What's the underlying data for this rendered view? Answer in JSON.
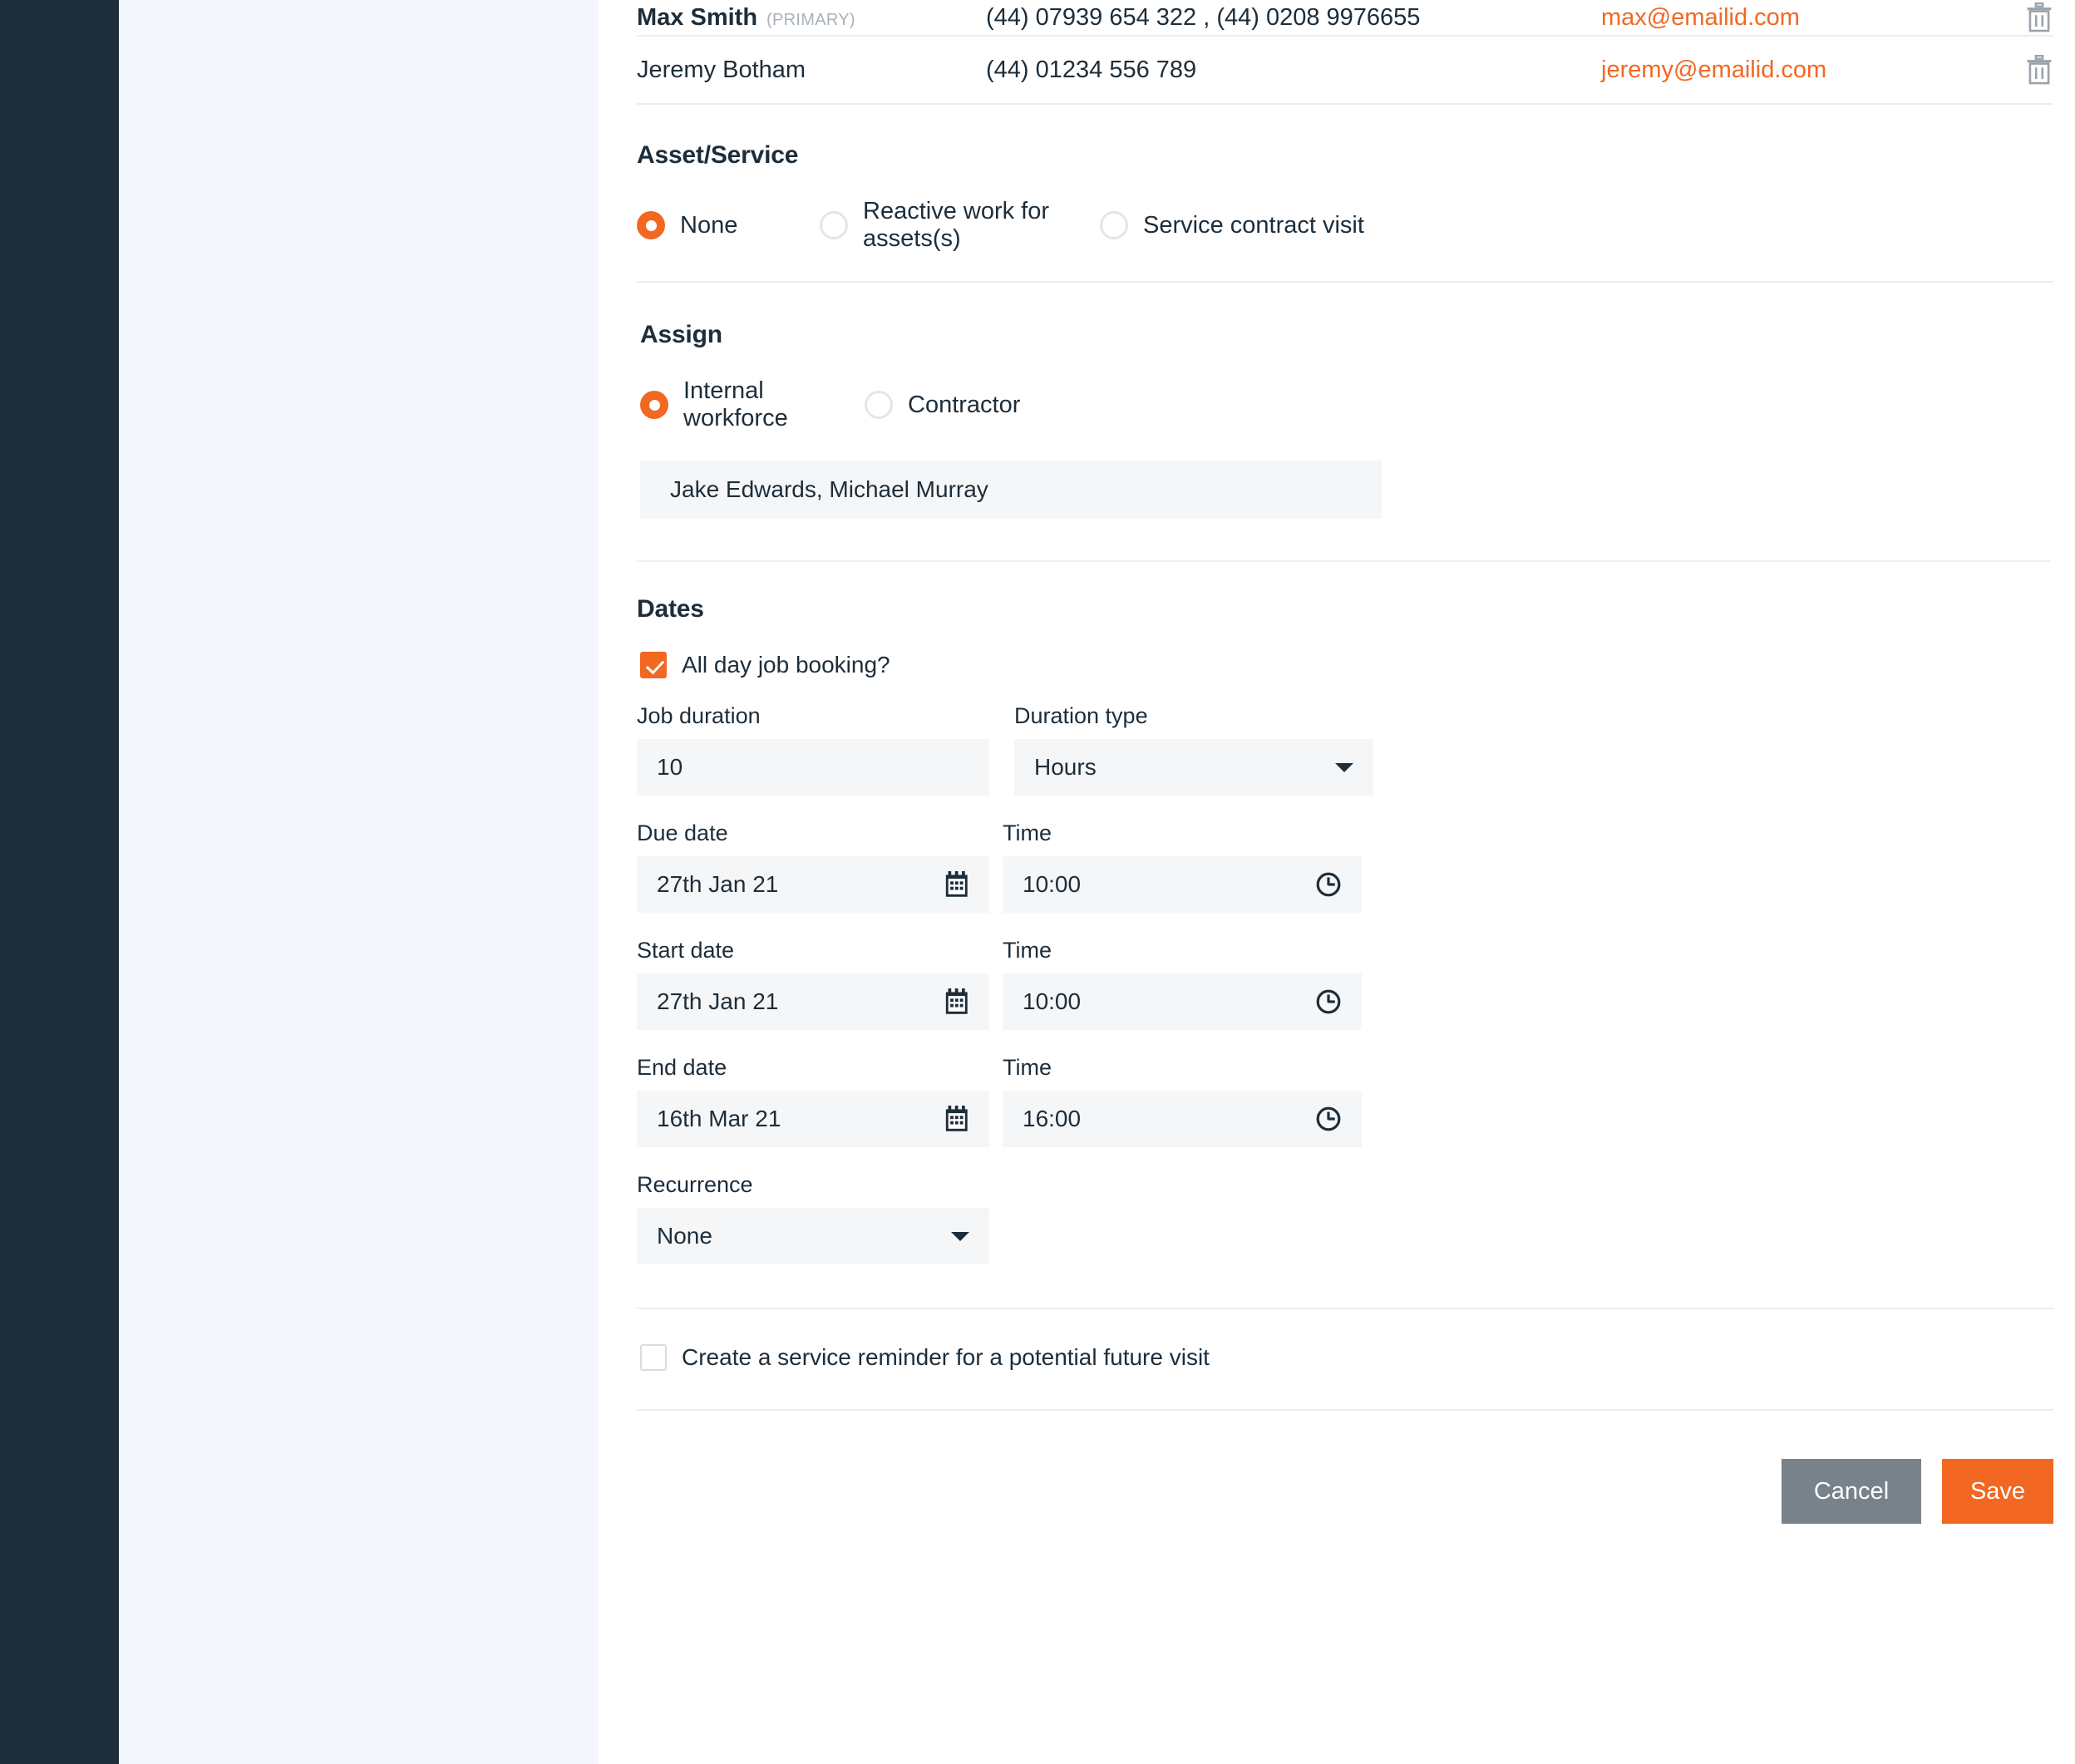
{
  "contacts": {
    "rows": [
      {
        "name": "Max Smith",
        "primary_tag": "(PRIMARY)",
        "phone": "(44) 07939 654 322 , (44) 0208 9976655",
        "email": "max@emailid.com",
        "delete_icon": "trash-icon"
      },
      {
        "name": "Jeremy Botham",
        "primary_tag": "",
        "phone": "(44) 01234 556 789",
        "email": "jeremy@emailid.com",
        "delete_icon": "trash-icon"
      }
    ]
  },
  "asset_service": {
    "title": "Asset/Service",
    "options": [
      {
        "label": "None",
        "selected": true
      },
      {
        "label": "Reactive work for assets(s)",
        "selected": false
      },
      {
        "label": "Service contract visit",
        "selected": false
      }
    ]
  },
  "assign": {
    "title": "Assign",
    "options": [
      {
        "label": "Internal workforce",
        "selected": true
      },
      {
        "label": "Contractor",
        "selected": false
      }
    ],
    "assignees": "Jake Edwards, Michael Murray"
  },
  "dates": {
    "title": "Dates",
    "all_day": {
      "label": "All day job booking?",
      "checked": true
    },
    "job_duration": {
      "label": "Job duration",
      "value": "10"
    },
    "duration_type": {
      "label": "Duration type",
      "value": "Hours",
      "icon": "chevron-down-icon"
    },
    "due": {
      "date_label": "Due date",
      "date_value": "27th Jan 21",
      "date_icon": "calendar-icon",
      "time_label": "Time",
      "time_value": "10:00",
      "time_icon": "clock-icon"
    },
    "start": {
      "date_label": "Start date",
      "date_value": "27th Jan 21",
      "date_icon": "calendar-icon",
      "time_label": "Time",
      "time_value": "10:00",
      "time_icon": "clock-icon"
    },
    "end": {
      "date_label": "End date",
      "date_value": "16th Mar 21",
      "date_icon": "calendar-icon",
      "time_label": "Time",
      "time_value": "16:00",
      "time_icon": "clock-icon"
    },
    "recurrence": {
      "label": "Recurrence",
      "value": "None",
      "icon": "chevron-down-icon"
    }
  },
  "reminder": {
    "label": "Create a service reminder for a potential future visit",
    "checked": false
  },
  "footer": {
    "cancel_label": "Cancel",
    "save_label": "Save"
  },
  "colors": {
    "accent": "#f26722",
    "dark": "#1d2d3a",
    "cancel_grey": "#78828a",
    "field_bg": "#f5f6f7",
    "backdrop": "#f3f7fb"
  }
}
